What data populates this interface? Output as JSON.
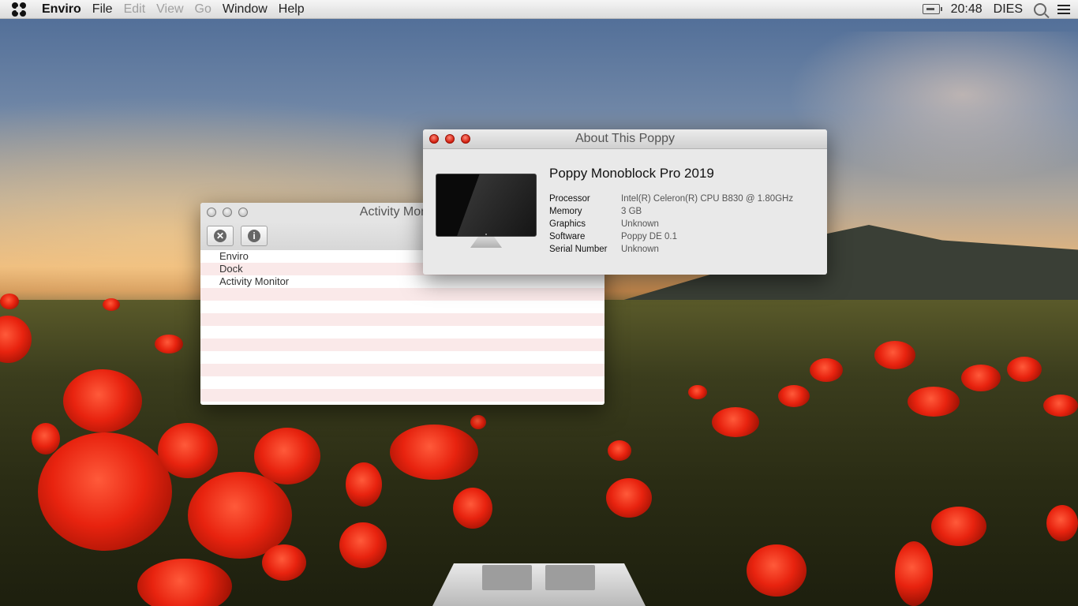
{
  "menubar": {
    "app_name": "Enviro",
    "items": [
      "File",
      "Edit",
      "View",
      "Go",
      "Window",
      "Help"
    ],
    "disabled": [
      "Edit",
      "View",
      "Go"
    ],
    "time": "20:48",
    "day": "DIES"
  },
  "activity_monitor": {
    "title": "Activity Monitor",
    "processes": [
      "Enviro",
      "Dock",
      "Activity Monitor"
    ]
  },
  "about": {
    "title": "About This Poppy",
    "model": "Poppy Monoblock Pro 2019",
    "specs": [
      {
        "label": "Processor",
        "value": "Intel(R) Celeron(R) CPU B830 @ 1.80GHz"
      },
      {
        "label": "Memory",
        "value": "3 GB"
      },
      {
        "label": "Graphics",
        "value": "Unknown"
      },
      {
        "label": "Software",
        "value": "Poppy DE 0.1"
      },
      {
        "label": "Serial Number",
        "value": "Unknown"
      }
    ]
  },
  "colors": {
    "close_red": "#d11c0c",
    "stripe_pink": "#fae9e9",
    "menubar_bg": "#e6e6e6"
  }
}
